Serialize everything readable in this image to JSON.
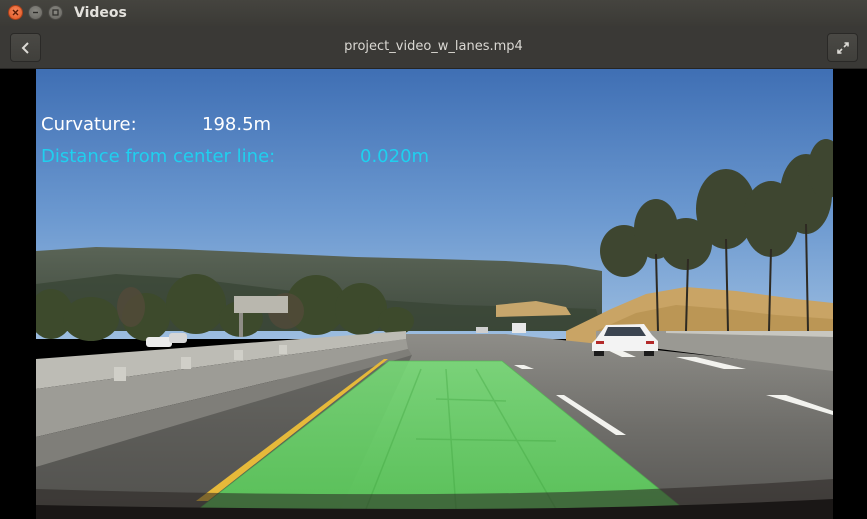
{
  "window": {
    "title": "Videos"
  },
  "header": {
    "file_name": "project_video_w_lanes.mp4"
  },
  "video": {
    "overlay": {
      "curvature_label": "Curvature:",
      "curvature_value": "198.5m",
      "distance_label": "Distance from center line:",
      "distance_value": "0.020m"
    }
  },
  "icons": {
    "close": "close-icon",
    "minimize": "minimize-icon",
    "maximize": "maximize-icon",
    "back": "chevron-left-icon",
    "fullscreen": "fullscreen-icon"
  },
  "colors": {
    "titlebar": "#3e3d39",
    "close_button": "#e9581f",
    "overlay_curvature": "#ffffff",
    "overlay_distance": "#1fd0ef",
    "lane_fill": "#6ee66e"
  }
}
